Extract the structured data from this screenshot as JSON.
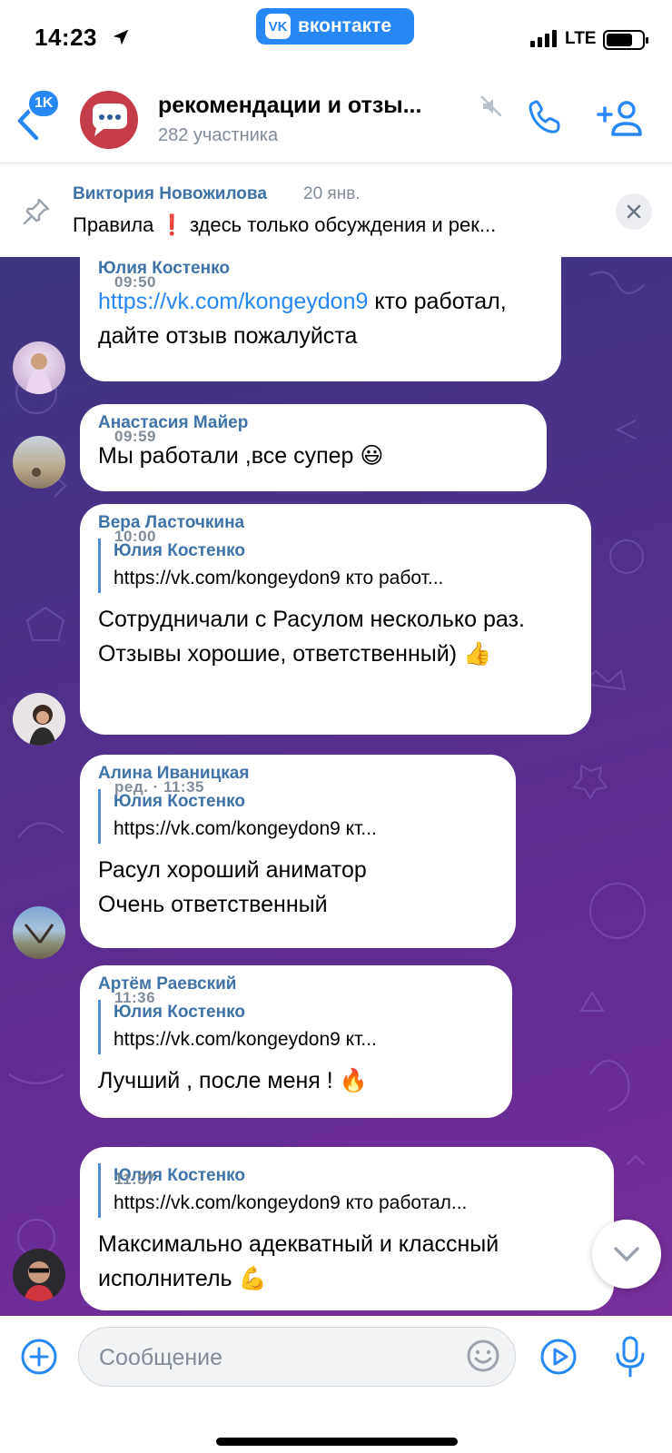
{
  "status_bar": {
    "time": "14:23",
    "app_pill": "вконтакте",
    "app_pill_logo": "VK",
    "network": "LTE"
  },
  "header": {
    "unread_badge": "1K",
    "title": "рекомендации и отзы...",
    "subtitle": "282 участника",
    "icons": [
      "back-icon",
      "mute-icon",
      "phone-icon",
      "add-user-icon"
    ]
  },
  "pinned": {
    "author": "Виктория Новожилова",
    "date": "20 янв.",
    "text": "Правила ❗️ здесь только обсуждения и рек..."
  },
  "messages": [
    {
      "author": "Юлия Костенко",
      "link": "https://vk.com/kongeydon9",
      "text_after_link": " кто работал, дайте отзыв пожалуйста",
      "time": "09:50"
    },
    {
      "author": "Анастасия Майер",
      "text": "Мы работали ,все супер 😃",
      "time": "09:59"
    },
    {
      "author": "Вера Ласточкина",
      "reply_author": "Юлия Костенко",
      "reply_text": "https://vk.com/kongeydon9 кто работ...",
      "text": "Сотрудничали с Расулом несколько раз. Отзывы хорошие, ответственный) 👍",
      "time": "10:00"
    },
    {
      "author": "Алина Иваницкая",
      "reply_author": "Юлия Костенко",
      "reply_text": "https://vk.com/kongeydon9 кт...",
      "text_line1": "Расул хороший аниматор",
      "text_line2": "Очень ответственный",
      "time": "ред. · 11:35"
    },
    {
      "author": "Артём Раевский",
      "reply_author": "Юлия Костенко",
      "reply_text": "https://vk.com/kongeydon9 кт...",
      "text": "Лучший , после меня ! 🔥",
      "time": "11:36"
    },
    {
      "reply_author": "Юлия Костенко",
      "reply_text": "https://vk.com/kongeydon9 кто работал...",
      "text": "Максимально адекватный и классный исполнитель 💪",
      "time": "11:37"
    }
  ],
  "composer": {
    "placeholder": "Сообщение",
    "icons": [
      "plus-icon",
      "emoji-icon",
      "play-icon",
      "mic-icon"
    ]
  },
  "colors": {
    "accent": "#2787f5",
    "author": "#3f72a8",
    "chat_bg_top": "#3d3580",
    "chat_bg_bottom": "#7a2f9c"
  }
}
